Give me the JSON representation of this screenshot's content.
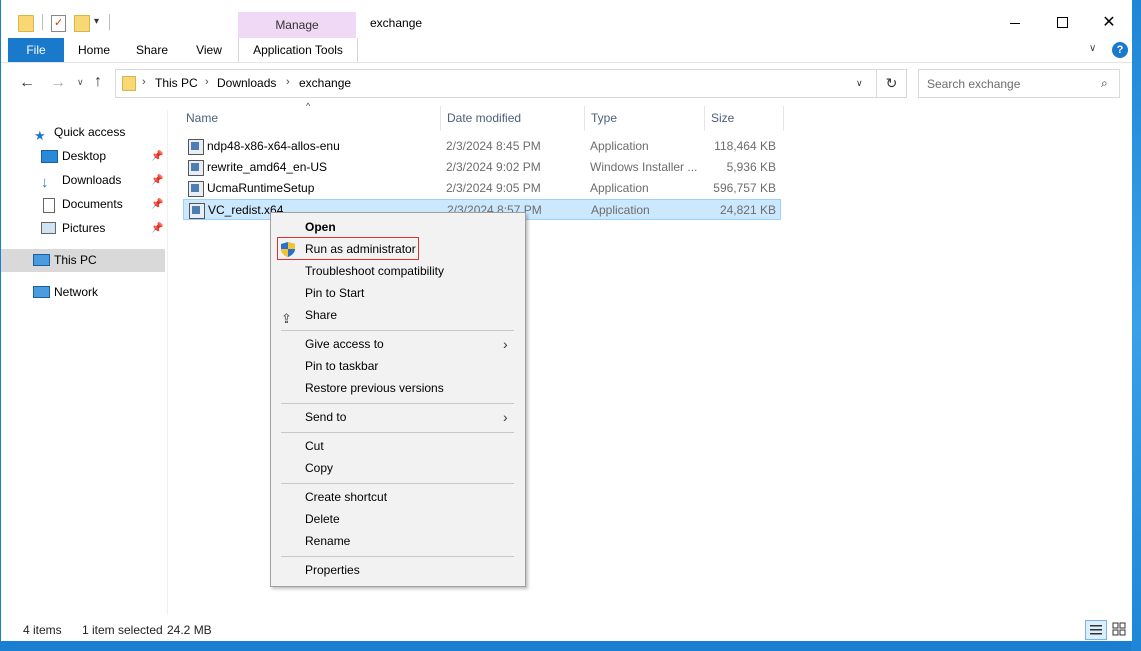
{
  "window": {
    "title": "exchange",
    "manage_tab": "Manage"
  },
  "ribbon": {
    "tabs": [
      "File",
      "Home",
      "Share",
      "View",
      "Application Tools"
    ]
  },
  "addressbar": {
    "breadcrumbs": [
      "This PC",
      "Downloads",
      "exchange"
    ],
    "search_placeholder": "Search exchange"
  },
  "sidebar": {
    "items": [
      {
        "label": "Quick access",
        "icon": "star-icon"
      },
      {
        "label": "Desktop",
        "icon": "desktop-icon",
        "pinned": true
      },
      {
        "label": "Downloads",
        "icon": "download-icon",
        "pinned": true
      },
      {
        "label": "Documents",
        "icon": "documents-icon",
        "pinned": true
      },
      {
        "label": "Pictures",
        "icon": "pictures-icon",
        "pinned": true
      },
      {
        "label": "This PC",
        "icon": "computer-icon",
        "selected": true
      },
      {
        "label": "Network",
        "icon": "network-icon"
      }
    ]
  },
  "filelist": {
    "columns": [
      "Name",
      "Date modified",
      "Type",
      "Size"
    ],
    "rows": [
      {
        "name": "ndp48-x86-x64-allos-enu",
        "date": "2/3/2024 8:45 PM",
        "type": "Application",
        "size": "118,464 KB"
      },
      {
        "name": "rewrite_amd64_en-US",
        "date": "2/3/2024 9:02 PM",
        "type": "Windows Installer ...",
        "size": "5,936 KB"
      },
      {
        "name": "UcmaRuntimeSetup",
        "date": "2/3/2024 9:05 PM",
        "type": "Application",
        "size": "596,757 KB"
      },
      {
        "name": "VC_redist.x64",
        "date": "2/3/2024 8:57 PM",
        "type": "Application",
        "size": "24,821 KB",
        "selected": true
      }
    ]
  },
  "context_menu": {
    "items": [
      "Open",
      "Run as administrator",
      "Troubleshoot compatibility",
      "Pin to Start",
      "Share",
      "Give access to",
      "Pin to taskbar",
      "Restore previous versions",
      "Send to",
      "Cut",
      "Copy",
      "Create shortcut",
      "Delete",
      "Rename",
      "Properties"
    ]
  },
  "statusbar": {
    "count": "4 items",
    "selected": "1 item selected",
    "size": "24.2 MB"
  },
  "colors": {
    "accent": "#1979ca",
    "selection": "#cce8ff",
    "manage_tab": "#f0d9f5",
    "highlight_border": "#e0312f"
  }
}
